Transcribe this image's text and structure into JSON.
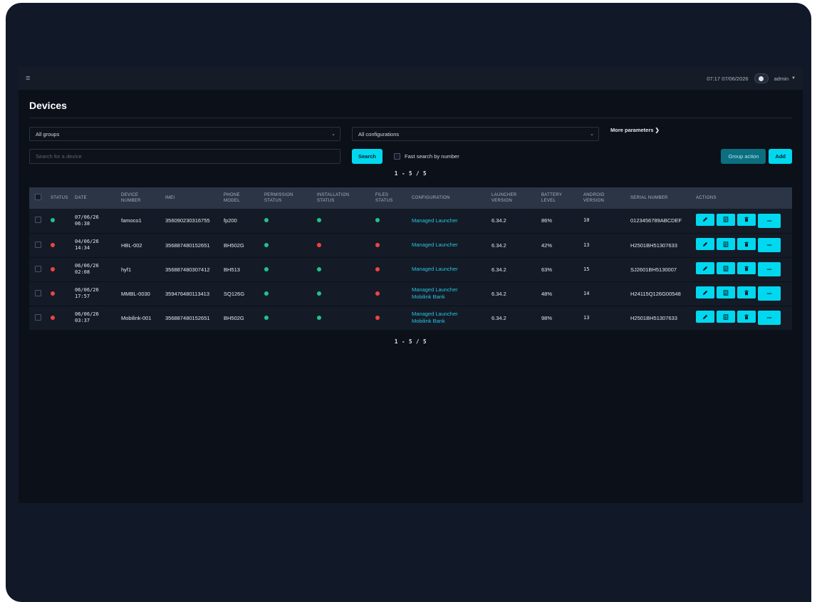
{
  "topbar": {
    "datetime": "07:17 07/06/2026",
    "user": "admin"
  },
  "page": {
    "title": "Devices"
  },
  "filters": {
    "groups_value": "All groups",
    "configurations_value": "All configurations",
    "more_parameters": "More parameters"
  },
  "search": {
    "placeholder": "Search for a device",
    "button": "Search",
    "fast_search_label": "Fast search by number",
    "group_action": "Group action",
    "add": "Add"
  },
  "pager": "1 - 5 / 5",
  "table": {
    "headers": {
      "status": "STATUS",
      "date": "DATE",
      "device_number_1": "DEVICE",
      "device_number_2": "NUMBER",
      "imei": "IMEI",
      "phone_model_1": "PHONE",
      "phone_model_2": "MODEL",
      "permission_1": "PERMISSION",
      "permission_2": "STATUS",
      "installation_1": "INSTALLATION",
      "installation_2": "STATUS",
      "files_1": "FILES",
      "files_2": "STATUS",
      "configuration": "CONFIGURATION",
      "launcher_1": "LAUNCHER",
      "launcher_2": "VERSION",
      "battery_1": "BATTERY",
      "battery_2": "LEVEL",
      "android_1": "ANDROID",
      "android_2": "VERSION",
      "serial": "SERIAL NUMBER",
      "actions": "ACTIONS"
    },
    "rows": [
      {
        "status_color": "#22c28a",
        "date_1": "07/06/26",
        "date_2": "06:38",
        "device_number": "famoco1",
        "imei": "356090230316755",
        "model": "fp200",
        "permission_color": "#22c28a",
        "installation_color": "#22c28a",
        "files_color": "#22c28a",
        "config_1": "Managed Launcher",
        "config_2": "",
        "launcher_version": "6.34.2",
        "battery": "86%",
        "android": "10",
        "serial": "0123456789ABCDEF"
      },
      {
        "status_color": "#ef4444",
        "date_1": "04/06/26",
        "date_2": "14:34",
        "device_number": "HBL-002",
        "imei": "356887480152651",
        "model": "BH502G",
        "permission_color": "#22c28a",
        "installation_color": "#ef4444",
        "files_color": "#ef4444",
        "config_1": "Managed Launcher",
        "config_2": "",
        "launcher_version": "6.34.2",
        "battery": "42%",
        "android": "13",
        "serial": "H2501BH51307633"
      },
      {
        "status_color": "#ef4444",
        "date_1": "06/06/26",
        "date_2": "02:08",
        "device_number": "hyf1",
        "imei": "356887480307412",
        "model": "BH513",
        "permission_color": "#22c28a",
        "installation_color": "#22c28a",
        "files_color": "#ef4444",
        "config_1": "Managed Launcher",
        "config_2": "",
        "launcher_version": "6.34.2",
        "battery": "63%",
        "android": "15",
        "serial": "SJ2601BH5130007"
      },
      {
        "status_color": "#ef4444",
        "date_1": "06/06/26",
        "date_2": "17:57",
        "device_number": "MMBL-0030",
        "imei": "359476480113413",
        "model": "SQ126G",
        "permission_color": "#22c28a",
        "installation_color": "#22c28a",
        "files_color": "#ef4444",
        "config_1": "Managed Launcher",
        "config_2": "Mobilink Bank",
        "launcher_version": "6.34.2",
        "battery": "48%",
        "android": "14",
        "serial": "H24115Q126G00548"
      },
      {
        "status_color": "#ef4444",
        "date_1": "06/06/26",
        "date_2": "03:37",
        "device_number": "Mobilink-001",
        "imei": "356887480152651",
        "model": "BH502G",
        "permission_color": "#22c28a",
        "installation_color": "#22c28a",
        "files_color": "#ef4444",
        "config_1": "Managed Launcher",
        "config_2": "Mobilink Bank",
        "launcher_version": "6.34.2",
        "battery": "98%",
        "android": "13",
        "serial": "H2501BH51307633"
      }
    ],
    "action_icons": [
      "pencil-icon",
      "details-icon",
      "trash-icon",
      "more-icon"
    ]
  }
}
